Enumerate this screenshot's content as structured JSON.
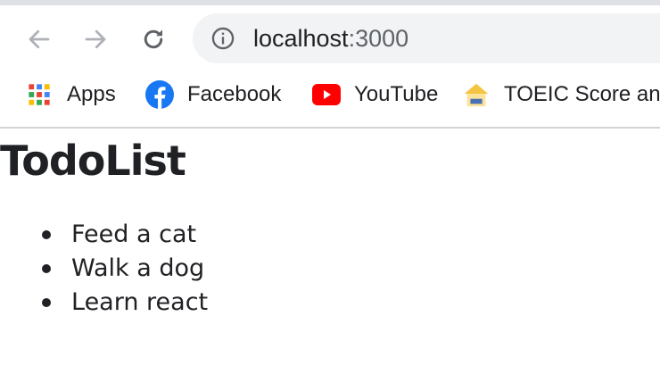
{
  "browser": {
    "url_host": "localhost",
    "url_port": ":3000",
    "icons": {
      "back": "arrow-left-icon",
      "forward": "arrow-right-icon",
      "reload": "reload-icon",
      "site_info": "info-circle-icon"
    },
    "bookmarks": [
      {
        "label": "Apps",
        "icon": "apps-grid-icon"
      },
      {
        "label": "Facebook",
        "icon": "facebook-icon",
        "color": "#1877f2"
      },
      {
        "label": "YouTube",
        "icon": "youtube-icon",
        "color": "#ff0000"
      },
      {
        "label": "TOEIC Score and",
        "icon": "toeic-site-icon"
      }
    ]
  },
  "page": {
    "title": "TodoList",
    "todos": [
      "Feed a cat",
      "Walk a dog",
      "Learn react"
    ]
  }
}
